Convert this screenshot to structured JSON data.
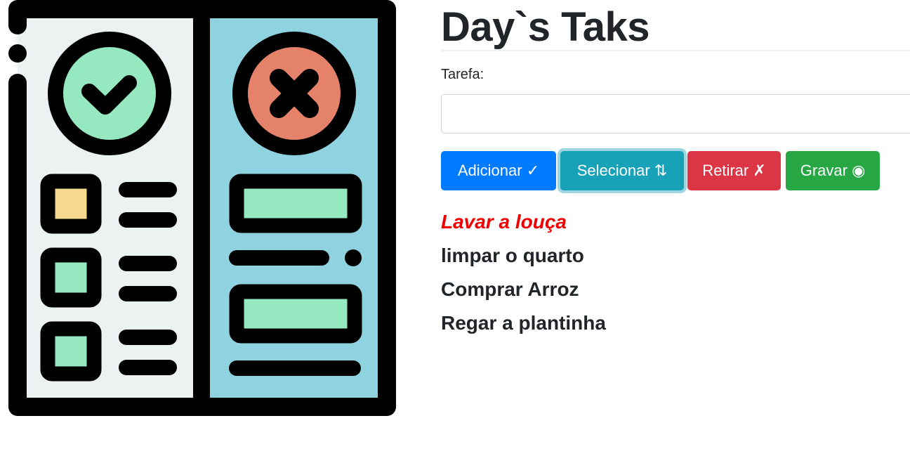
{
  "header": {
    "title": "Day`s Taks"
  },
  "form": {
    "label": "Tarefa:",
    "input_value": "",
    "input_placeholder": ""
  },
  "buttons": {
    "add": "Adicionar ✓",
    "select": "Selecionar ⇅",
    "remove": "Retirar ✗",
    "save": "Gravar ◉"
  },
  "tasks": [
    {
      "label": "Lavar a louça",
      "selected": true
    },
    {
      "label": "limpar o quarto",
      "selected": false
    },
    {
      "label": "Comprar Arroz",
      "selected": false
    },
    {
      "label": "Regar a plantinha",
      "selected": false
    }
  ],
  "colors": {
    "primary": "#007bff",
    "info": "#17a2b8",
    "danger": "#dc3545",
    "success": "#28a745",
    "selected_task": "#ee0000"
  },
  "illustration": {
    "icon_left": "check-icon",
    "icon_right": "close-icon"
  }
}
